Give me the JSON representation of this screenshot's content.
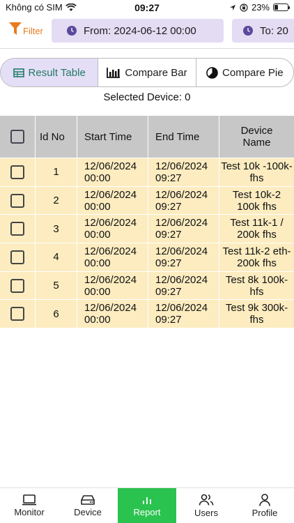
{
  "status": {
    "carrier": "Không có SIM",
    "time": "09:27",
    "battery": "23%",
    "battery_level": 0.23
  },
  "filter": {
    "label": "Filter",
    "from": "From: 2024-06-12 00:00",
    "to": "To: 20"
  },
  "tabs": [
    {
      "label": "Result Table",
      "icon": "table-icon",
      "active": true
    },
    {
      "label": "Compare Bar",
      "icon": "bar-chart-icon",
      "active": false
    },
    {
      "label": "Compare Pie",
      "icon": "pie-chart-icon",
      "active": false
    }
  ],
  "selected_device": "Selected Device: 0",
  "table": {
    "headers": [
      "Id No",
      "Start Time",
      "End Time",
      "Device Name"
    ],
    "rows": [
      {
        "id": "1",
        "start": "12/06/2024 00:00",
        "end": "12/06/2024 09:27",
        "name": "Test 10k -100k-fhs"
      },
      {
        "id": "2",
        "start": "12/06/2024 00:00",
        "end": "12/06/2024 09:27",
        "name": "Test 10k-2 100k fhs"
      },
      {
        "id": "3",
        "start": "12/06/2024 00:00",
        "end": "12/06/2024 09:27",
        "name": "Test 11k-1 / 200k fhs"
      },
      {
        "id": "4",
        "start": "12/06/2024 00:00",
        "end": "12/06/2024 09:27",
        "name": "Test 11k-2 eth-200k fhs"
      },
      {
        "id": "5",
        "start": "12/06/2024 00:00",
        "end": "12/06/2024 09:27",
        "name": "Test 8k 100k-hfs"
      },
      {
        "id": "6",
        "start": "12/06/2024 00:00",
        "end": "12/06/2024 09:27",
        "name": "Test 9k 300k-fhs"
      }
    ]
  },
  "nav": [
    {
      "label": "Monitor",
      "icon": "monitor-icon"
    },
    {
      "label": "Device",
      "icon": "device-icon"
    },
    {
      "label": "Report",
      "icon": "report-icon",
      "active": true
    },
    {
      "label": "Users",
      "icon": "users-icon"
    },
    {
      "label": "Profile",
      "icon": "profile-icon"
    }
  ],
  "colors": {
    "accent_orange": "#e77b1e",
    "pill_bg": "#e3dcf3",
    "active_tab_text": "#1f7a66",
    "row_bg": "#fcecc0",
    "header_bg": "#c7c7c7",
    "nav_active": "#2ac34f"
  }
}
